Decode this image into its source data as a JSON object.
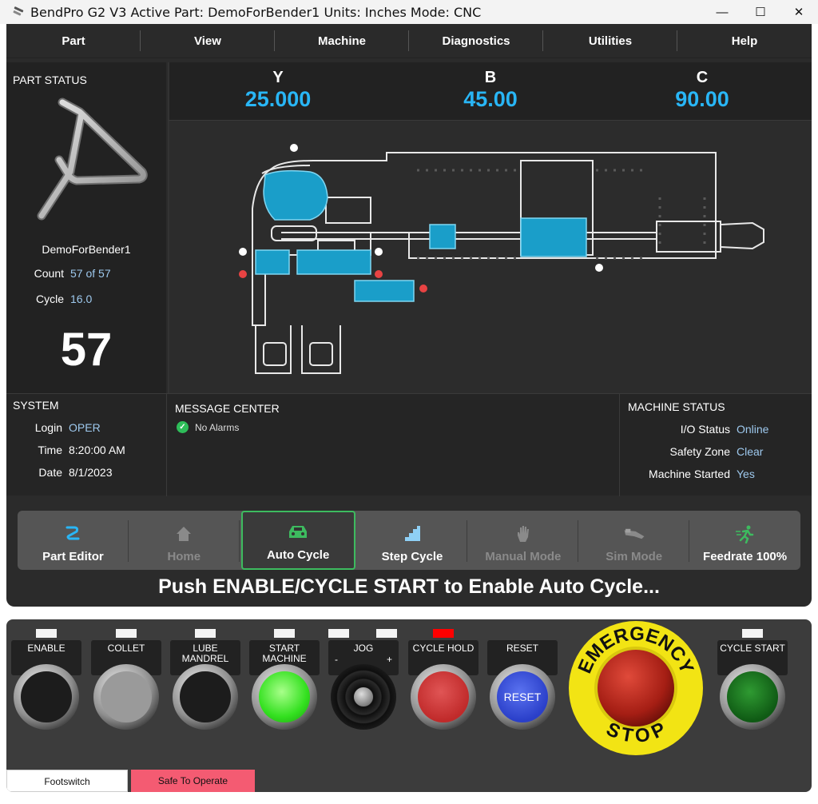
{
  "window": {
    "title": "BendPro G2 V3  Active Part: DemoForBender1  Units: Inches  Mode: CNC",
    "controls": [
      "—",
      "☐",
      "✕"
    ]
  },
  "menu": [
    "Part",
    "View",
    "Machine",
    "Diagnostics",
    "Utilities",
    "Help"
  ],
  "part_status": {
    "title": "PART STATUS",
    "part_name": "DemoForBender1",
    "count_label": "Count",
    "count_value": "57 of 57",
    "cycle_label": "Cycle",
    "cycle_value": "16.0",
    "big_count": "57"
  },
  "axes": [
    {
      "name": "Y",
      "value": "25.000"
    },
    {
      "name": "B",
      "value": "45.00"
    },
    {
      "name": "C",
      "value": "90.00"
    }
  ],
  "system": {
    "title": "SYSTEM",
    "login_label": "Login",
    "login_value": "OPER",
    "time_label": "Time",
    "time_value": "8:20:00 AM",
    "date_label": "Date",
    "date_value": "8/1/2023"
  },
  "message_center": {
    "title": "MESSAGE CENTER",
    "message": "No Alarms"
  },
  "machine_status": {
    "title": "MACHINE STATUS",
    "io_label": "I/O Status",
    "io_value": "Online",
    "safety_label": "Safety Zone",
    "safety_value": "Clear",
    "started_label": "Machine Started",
    "started_value": "Yes"
  },
  "toolbar": [
    {
      "label": "Part Editor",
      "icon": "part-editor-icon",
      "state": "enabled"
    },
    {
      "label": "Home",
      "icon": "home-icon",
      "state": "disabled"
    },
    {
      "label": "Auto Cycle",
      "icon": "car-icon",
      "state": "active"
    },
    {
      "label": "Step Cycle",
      "icon": "stairs-icon",
      "state": "enabled"
    },
    {
      "label": "Manual Mode",
      "icon": "hand-icon",
      "state": "disabled"
    },
    {
      "label": "Sim Mode",
      "icon": "bender-icon",
      "state": "disabled"
    },
    {
      "label": "Feedrate 100%",
      "icon": "runner-icon",
      "state": "enabled"
    }
  ],
  "prompt": "Push ENABLE/CYCLE START to Enable Auto Cycle...",
  "panel": {
    "enable": "ENABLE",
    "collet": "COLLET",
    "lube": "LUBE\nMANDREL",
    "start": "START\nMACHINE",
    "jog": "JOG",
    "jog_minus": "-",
    "jog_plus": "+",
    "cycle_hold": "CYCLE HOLD",
    "reset": "RESET",
    "reset_cap": "RESET",
    "estop_top": "EMERGENCY",
    "estop_bottom": "STOP",
    "cycle_start": "CYCLE START",
    "footswitch": "Footswitch",
    "safe": "Safe To Operate"
  },
  "colors": {
    "accent_blue": "#29b6f6",
    "value_blue": "#9ec9ee",
    "active_green": "#3dbb5f",
    "safe_red": "#f45b72",
    "hold_lamp": "#ff0000"
  }
}
